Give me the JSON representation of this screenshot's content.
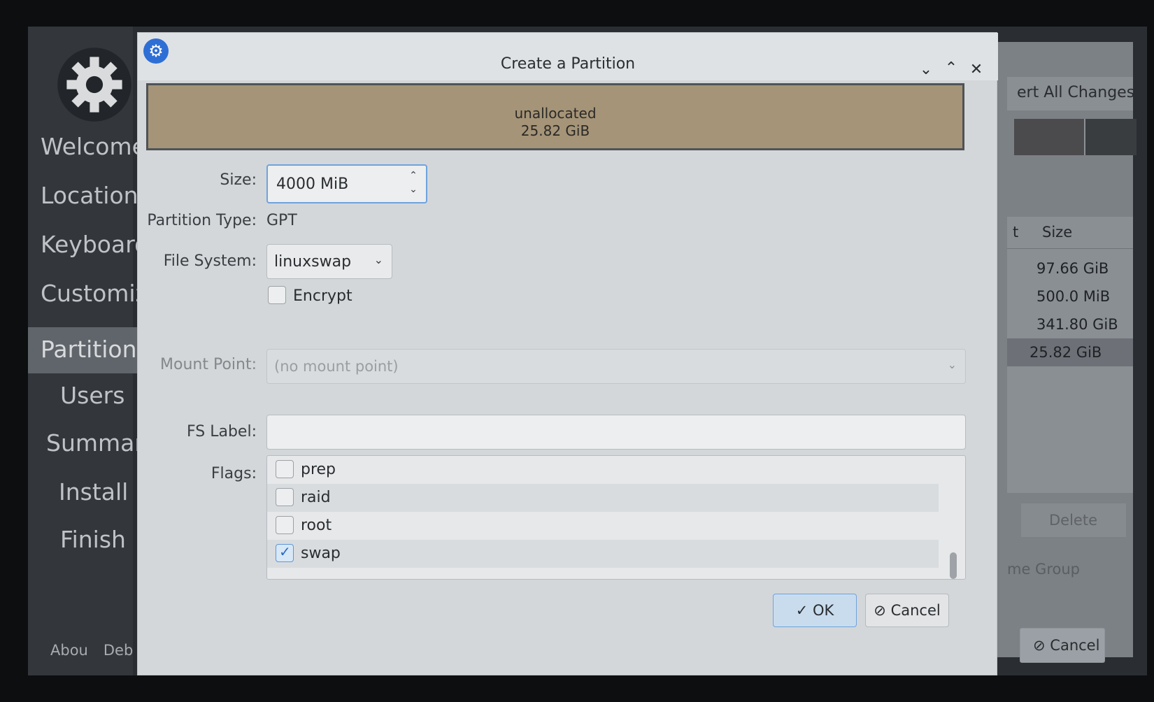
{
  "background": {
    "sidebar": {
      "items": [
        {
          "label": "Welcome"
        },
        {
          "label": "Location"
        },
        {
          "label": "Keyboard"
        },
        {
          "label": "Customize"
        },
        {
          "label": "Partitions",
          "active": true
        },
        {
          "label": "Users"
        },
        {
          "label": "Summary"
        },
        {
          "label": "Install"
        },
        {
          "label": "Finish"
        }
      ],
      "footer": {
        "about": "Abou",
        "debug": "Deb"
      }
    },
    "revert_label": "ert All Changes",
    "table": {
      "header_partial": "t",
      "header_size": "Size",
      "sizes": [
        "97.66 GiB",
        "500.0 MiB",
        "341.80 GiB",
        "25.82 GiB"
      ]
    },
    "delete_label": "Delete",
    "volume_group_label": "me Group",
    "cancel_label": "Cancel"
  },
  "dialog": {
    "title": "Create a Partition",
    "unallocated": {
      "name": "unallocated",
      "size": "25.82 GiB"
    },
    "size_label": "Size:",
    "size_value": "4000 MiB",
    "partition_type_label": "Partition Type:",
    "partition_type_value": "GPT",
    "file_system_label": "File System:",
    "file_system_value": "linuxswap",
    "encrypt_label": "Encrypt",
    "encrypt_checked": false,
    "mount_point_label": "Mount Point:",
    "mount_point_placeholder": "(no mount point)",
    "fs_label_label": "FS Label:",
    "fs_label_value": "",
    "flags_label": "Flags:",
    "flags": [
      {
        "label": "prep",
        "checked": false
      },
      {
        "label": "raid",
        "checked": false
      },
      {
        "label": "root",
        "checked": false
      },
      {
        "label": "swap",
        "checked": true
      }
    ],
    "ok_label": "OK",
    "cancel_label": "Cancel"
  }
}
